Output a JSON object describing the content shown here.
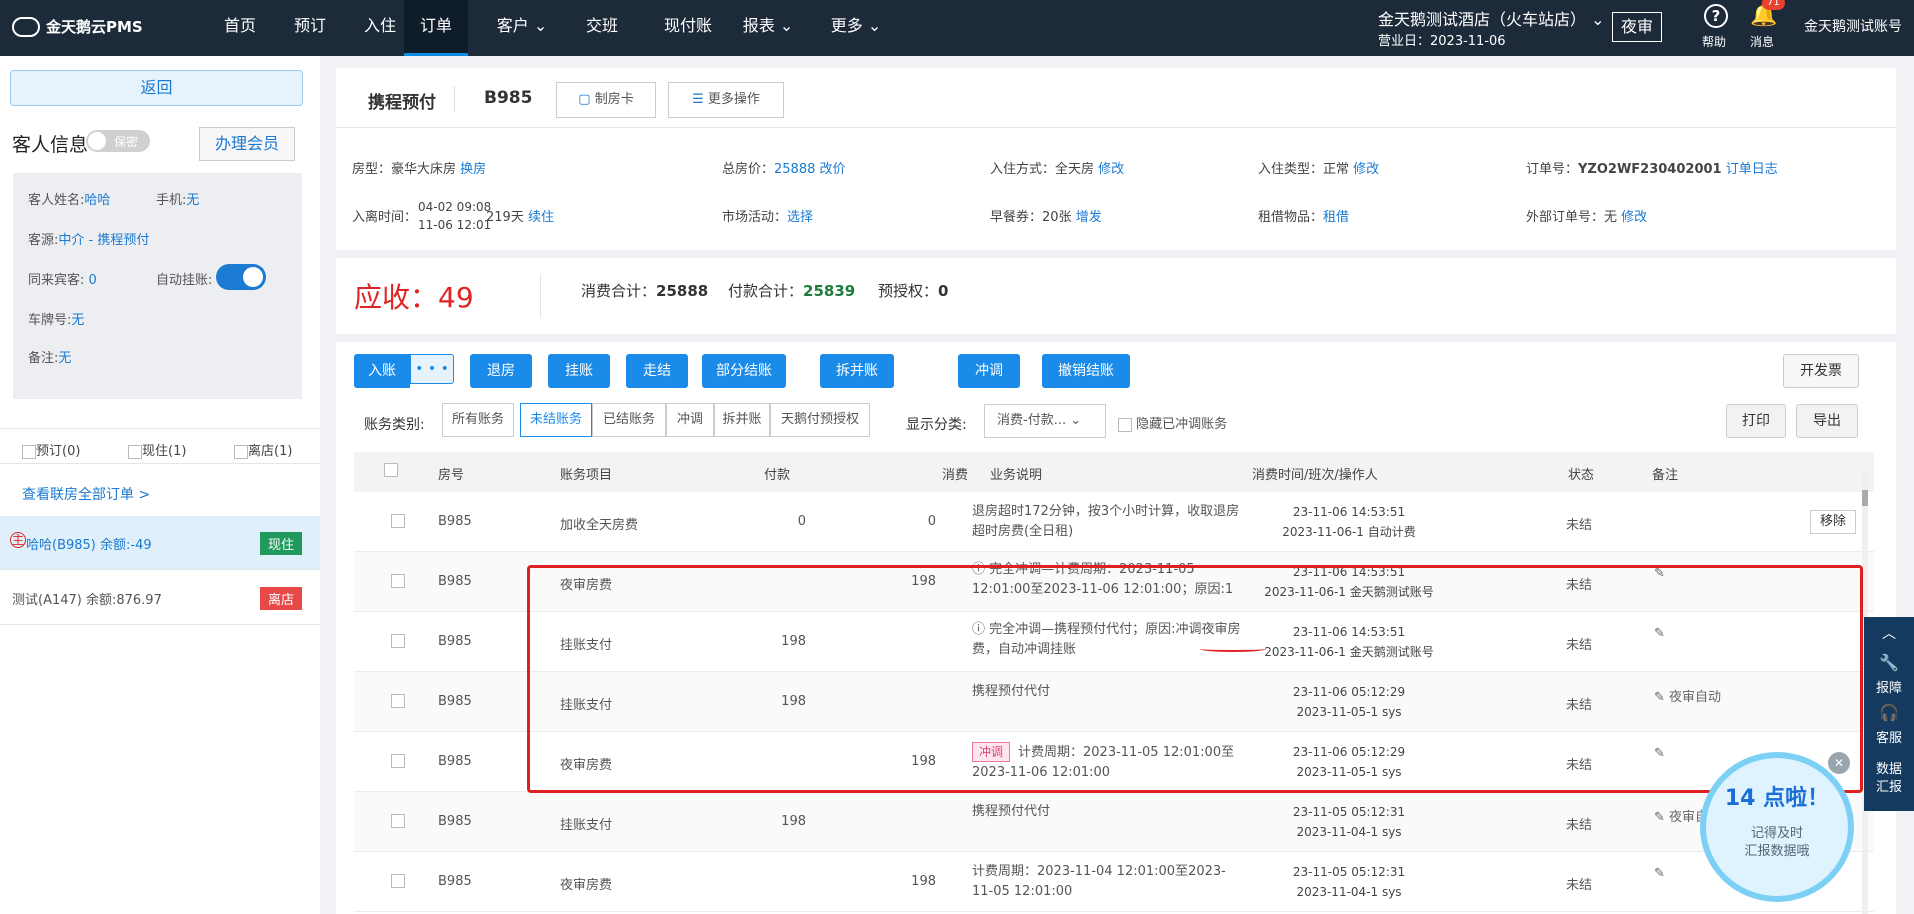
{
  "brand": {
    "name": "金天鹅云PMS"
  },
  "nav": {
    "items": [
      "首页",
      "预订",
      "入住",
      "订单",
      "客户",
      "交班",
      "现付账",
      "报表",
      "更多"
    ],
    "active_index": 3,
    "hotel": "金天鹅测试酒店（火车站店）",
    "business_date": "营业日：2023-11-06",
    "night_audit": "夜审",
    "help": "帮助",
    "messages": "消息",
    "messages_count": "71",
    "account": "金天鹅测试账号"
  },
  "sidebar": {
    "back": "返回",
    "guest_info_title": "客人信息",
    "privacy_toggle": "保密",
    "become_member": "办理会员",
    "name_label": "客人姓名:",
    "name_value": "哈哈",
    "phone_label": "手机:",
    "phone_value": "无",
    "source_label": "客源:",
    "source_value": "中介 - 携程预付",
    "companion_label": "同来宾客:",
    "companion_value": "0",
    "auto_hang_label": "自动挂账:",
    "plate_label": "车牌号:",
    "plate_value": "无",
    "remark_label": "备注:",
    "remark_value": "无",
    "filters": [
      "预订(0)",
      "现住(1)",
      "离店(1)"
    ],
    "view_all": "查看联房全部订单 >",
    "guests": [
      {
        "main_mark": "主",
        "text": "哈哈(B985)  余额:-49",
        "status": "现住",
        "status_color": "#1f9a5c"
      },
      {
        "text": "测试(A147)  余额:876.97",
        "status": "离店",
        "status_color": "#e84848"
      }
    ]
  },
  "header": {
    "channel": "携程预付",
    "room_no": "B985",
    "make_card": "制房卡",
    "more_ops": "更多操作"
  },
  "order": {
    "room_type_label": "房型：",
    "room_type": "豪华大床房",
    "change_room": "换房",
    "total_price_label": "总房价：",
    "total_price": "25888",
    "change_price": "改价",
    "checkin_method_label": "入住方式：",
    "checkin_method": "全天房",
    "modify": "修改",
    "checkin_type_label": "入住类型：",
    "checkin_type": "正常",
    "order_no_label": "订单号：",
    "order_no": "YZO2WF230402001",
    "order_log": "订单日志",
    "stay_label": "入离时间：",
    "stay_from": "04-02 09:08",
    "stay_to": "11-06 12:01",
    "stay_days": "219天",
    "extend": "续住",
    "market_label": "市场活动：",
    "market_select": "选择",
    "breakfast_label": "早餐券：",
    "breakfast": "20张",
    "breakfast_add": "增发",
    "rental_label": "租借物品：",
    "rental": "租借",
    "ext_order_label": "外部订单号：",
    "ext_order": "无"
  },
  "summary": {
    "receivable_label": "应收：",
    "receivable": "49",
    "consumption_label": "消费合计：",
    "consumption": "25888",
    "payment_label": "付款合计：",
    "payment": "25839",
    "preauth_label": "预授权：",
    "preauth": "0"
  },
  "actions": {
    "entry": "入账",
    "entry_more": "• • •",
    "buttons": [
      "退房",
      "挂账",
      "走结",
      "部分结账",
      "拆并账",
      "冲调",
      "撤销结账"
    ],
    "invoice": "开发票",
    "category_label": "账务类别:",
    "tabs": [
      "所有账务",
      "未结账务",
      "已结账务",
      "冲调",
      "拆并账",
      "天鹅付预授权"
    ],
    "active_tab": 1,
    "display_label": "显示分类:",
    "display_select": "消费-付款...",
    "hide_adjusted": "隐藏已冲调账务",
    "print": "打印",
    "export": "导出"
  },
  "table": {
    "headers": [
      "房号",
      "账务项目",
      "付款",
      "消费",
      "业务说明",
      "消费时间/班次/操作人",
      "状态",
      "备注"
    ],
    "rows": [
      {
        "room": "B985",
        "item": "加收全天房费",
        "item_red": false,
        "pay": "0",
        "cons": "0",
        "cons_red": false,
        "desc": "退房超时172分钟，按3个小时计算，收取退房超时房费(全日租)",
        "desc_type": "plain",
        "time1": "23-11-06 14:53:51",
        "time2": "2023-11-06-1 自动计费",
        "status": "未结",
        "note": "",
        "remove": "移除"
      },
      {
        "room": "B985",
        "item": "夜审房费",
        "item_red": true,
        "pay": "",
        "cons": "198",
        "cons_red": true,
        "desc": "ⓘ 完全冲调—计费周期：2023-11-05 12:01:00至2023-11-06 12:01:00；原因:1",
        "desc_type": "blue",
        "time1": "23-11-06 14:53:51",
        "time2": "2023-11-06-1 金天鹅测试账号",
        "status": "未结",
        "note": "✎"
      },
      {
        "room": "B985",
        "item": "挂账支付",
        "item_red": true,
        "pay": "198",
        "cons": "",
        "cons_red": false,
        "desc": "ⓘ 完全冲调—携程预付代付；原因:冲调夜审房费，自动冲调挂账",
        "desc_type": "blue",
        "time1": "23-11-06 14:53:51",
        "time2": "2023-11-06-1 金天鹅测试账号",
        "status": "未结",
        "note": "✎"
      },
      {
        "room": "B985",
        "item": "挂账支付",
        "item_red": true,
        "pay": "198",
        "cons": "",
        "cons_red": false,
        "desc": "携程预付代付",
        "desc_type": "plain",
        "time1": "23-11-06 05:12:29",
        "time2": "2023-11-05-1 sys",
        "status": "未结",
        "note": "✎ 夜审自动"
      },
      {
        "room": "B985",
        "item": "夜审房费",
        "item_red": true,
        "pay": "",
        "cons": "198",
        "cons_red": true,
        "desc": "计费周期：2023-11-05 12:01:00至2023-11-06 12:01:00",
        "desc_type": "tag",
        "tag": "冲调",
        "time1": "23-11-06 05:12:29",
        "time2": "2023-11-05-1 sys",
        "status": "未结",
        "note": "✎"
      },
      {
        "room": "B985",
        "item": "挂账支付",
        "item_red": false,
        "pay": "198",
        "cons": "",
        "cons_red": false,
        "desc": "携程预付代付",
        "desc_type": "plain",
        "time1": "23-11-05 05:12:31",
        "time2": "2023-11-04-1 sys",
        "status": "未结",
        "note": "✎ 夜审自"
      },
      {
        "room": "B985",
        "item": "夜审房费",
        "item_red": false,
        "pay": "",
        "cons": "198",
        "cons_red": false,
        "desc": "计费周期：2023-11-04 12:01:00至2023-11-05 12:01:00",
        "desc_type": "plain",
        "time1": "23-11-05 05:12:31",
        "time2": "2023-11-04-1 sys",
        "status": "未结",
        "note": "✎"
      }
    ]
  },
  "right_bar": {
    "items": [
      "报障",
      "客服",
      "数据汇报"
    ]
  },
  "promo": {
    "title": "14 点啦！",
    "line1": "记得及时",
    "line2": "汇报数据哦"
  },
  "colors": {
    "nav_bg": "#1c2a3a",
    "accent": "#1b8bea",
    "red": "#e02424",
    "green": "#1f7a3d"
  }
}
